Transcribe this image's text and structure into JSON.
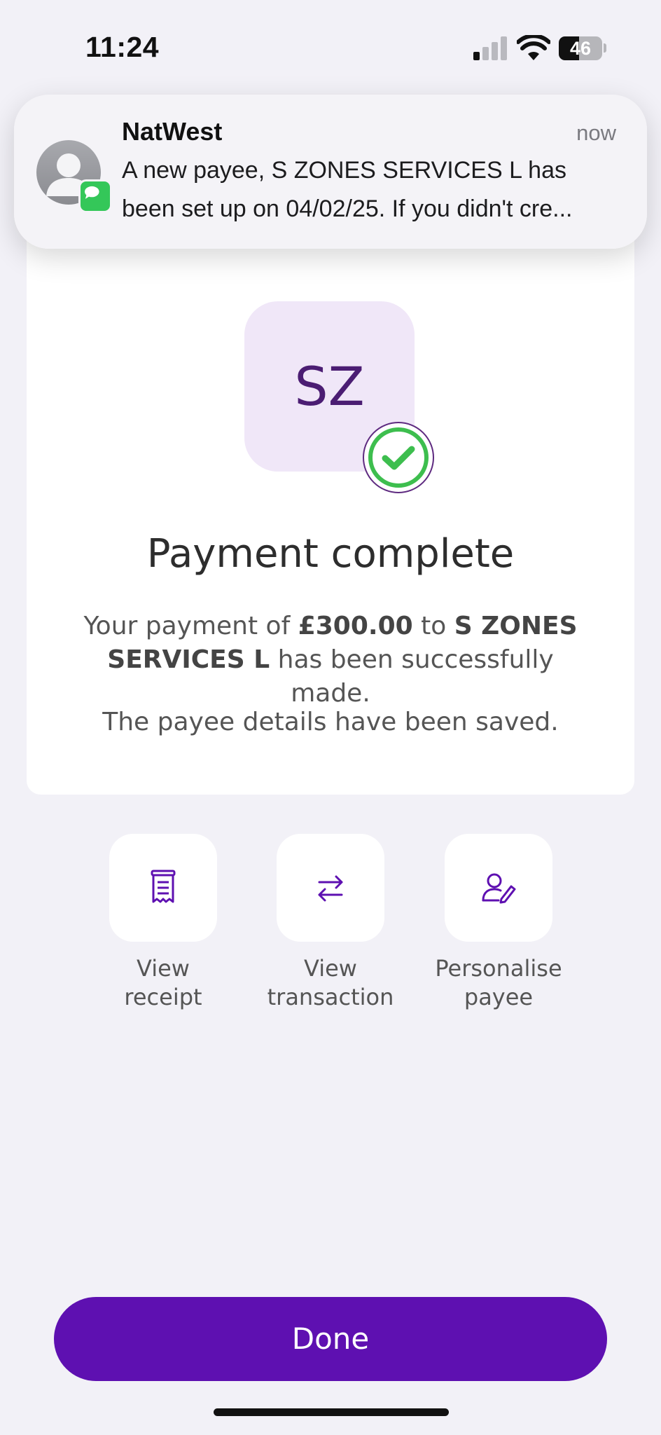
{
  "status_bar": {
    "time": "11:24",
    "battery_level": "46",
    "signal_bars_active": 1,
    "signal_bars_total": 4
  },
  "notification": {
    "app_name": "NatWest",
    "time": "now",
    "body_line1": "A new payee, S ZONES SERVICES L has",
    "body_line2": "been set up on 04/02/25. If you didn't cre...",
    "avatar_icon": "contact-avatar-icon",
    "app_badge_icon": "messages-icon"
  },
  "payee": {
    "initials": "SZ",
    "status_icon": "checkmark-circle-icon"
  },
  "result": {
    "title": "Payment complete",
    "message_prefix": "Your payment of ",
    "amount": "£300.00",
    "message_middle": " to ",
    "payee_name": "S ZONES SERVICES L",
    "message_suffix": " has been successfully made.",
    "saved_message": "The payee details have been saved."
  },
  "actions": [
    {
      "label_line1": "View",
      "label_line2": "receipt",
      "icon": "receipt-icon"
    },
    {
      "label_line1": "View",
      "label_line2": "transaction",
      "icon": "transfer-arrows-icon"
    },
    {
      "label_line1": "Personalise",
      "label_line2": "payee",
      "icon": "edit-person-icon"
    }
  ],
  "done_button": {
    "label": "Done"
  },
  "colors": {
    "brand_purple": "#5e10b1",
    "initials_tile": "#f0e7f8",
    "success_green": "#3dbe4e",
    "background": "#f2f1f7"
  }
}
